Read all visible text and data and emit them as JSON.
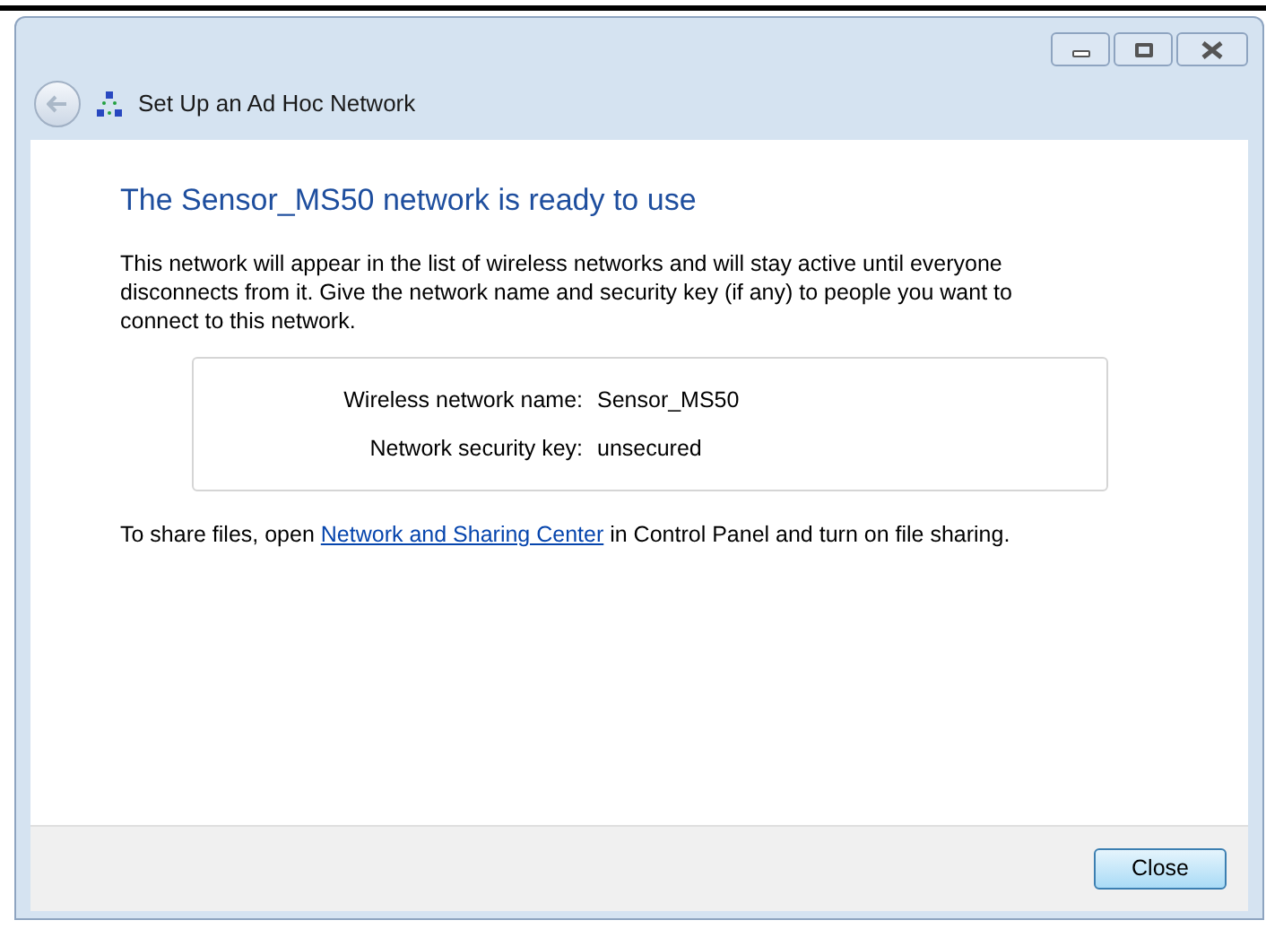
{
  "window": {
    "title": "Set Up an Ad Hoc Network"
  },
  "heading": "The Sensor_MS50 network is ready to use",
  "description": "This network will appear in the list of wireless networks and will stay active until everyone disconnects from it. Give the network name and security key (if any) to people you want to connect to this network.",
  "details": [
    {
      "label": "Wireless network name:",
      "value": "Sensor_MS50"
    },
    {
      "label": "Network security key:",
      "value": "unsecured"
    }
  ],
  "share_note": {
    "before": "To share files, open",
    "link": "Network and Sharing Center",
    "after": "in Control Panel and turn on file sharing."
  },
  "buttons": [
    {
      "label": "Close",
      "default": true
    }
  ]
}
